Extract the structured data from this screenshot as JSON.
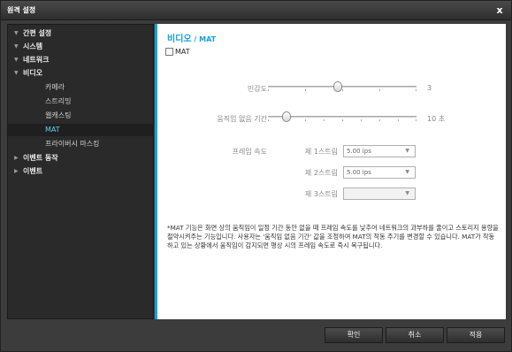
{
  "window": {
    "title": "원격 설정",
    "close_glyph": "x"
  },
  "sidebar": {
    "items": [
      {
        "label": "간편 설정",
        "arrow": "▼"
      },
      {
        "label": "시스템",
        "arrow": "▼"
      },
      {
        "label": "네트워크",
        "arrow": "▼"
      },
      {
        "label": "비디오",
        "arrow": "▼"
      }
    ],
    "video_subitems": [
      "카메라",
      "스트리밍",
      "웹캐스팅",
      "MAT",
      "프라이버시 마스킹"
    ],
    "lower_items": [
      {
        "label": "이벤트 동작",
        "arrow": "▶"
      },
      {
        "label": "이벤트",
        "arrow": "▶"
      }
    ],
    "active_item": "MAT"
  },
  "main": {
    "breadcrumb": {
      "parent": "비디오",
      "separator": " / ",
      "current": "MAT"
    },
    "mat_checkbox": {
      "label": "MAT",
      "checked": false
    },
    "sensitivity": {
      "label": "민감도",
      "value": "3",
      "level_fraction": 0.47
    },
    "inactivity": {
      "label": "움직임 없음 기간",
      "value": "10 초",
      "level_fraction": 0.1
    },
    "frame_rate": {
      "label": "프레임 속도",
      "streams": [
        {
          "label": "제 1스트림",
          "value": "5.00 ips",
          "enabled": true
        },
        {
          "label": "제 2스트림",
          "value": "5.00 ips",
          "enabled": true
        },
        {
          "label": "제 3스트림",
          "value": "",
          "enabled": false
        }
      ]
    },
    "note": "*MAT 기능은 화면 상의 움직임이 일정 기간 동안 없을 때 프레임 속도를 낮추어 네트워크의 과부하를 줄이고 스토리지 용량을 절약시켜주는 기능입니다. 사용자는 '움직임 없음 기간' 값을 조정하여 MAT의 작동 주기를 변경할 수 있습니다. MAT가 작동하고 있는 상황에서 움직임이 감지되면 평상 시의 프레임 속도로 즉시 복구됩니다."
  },
  "footer": {
    "confirm": "확인",
    "cancel": "취소",
    "apply": "적용"
  },
  "colors": {
    "accent": "#16a3d4",
    "active_text": "#5fd3f3",
    "window_bg": "#3c3c3c"
  }
}
